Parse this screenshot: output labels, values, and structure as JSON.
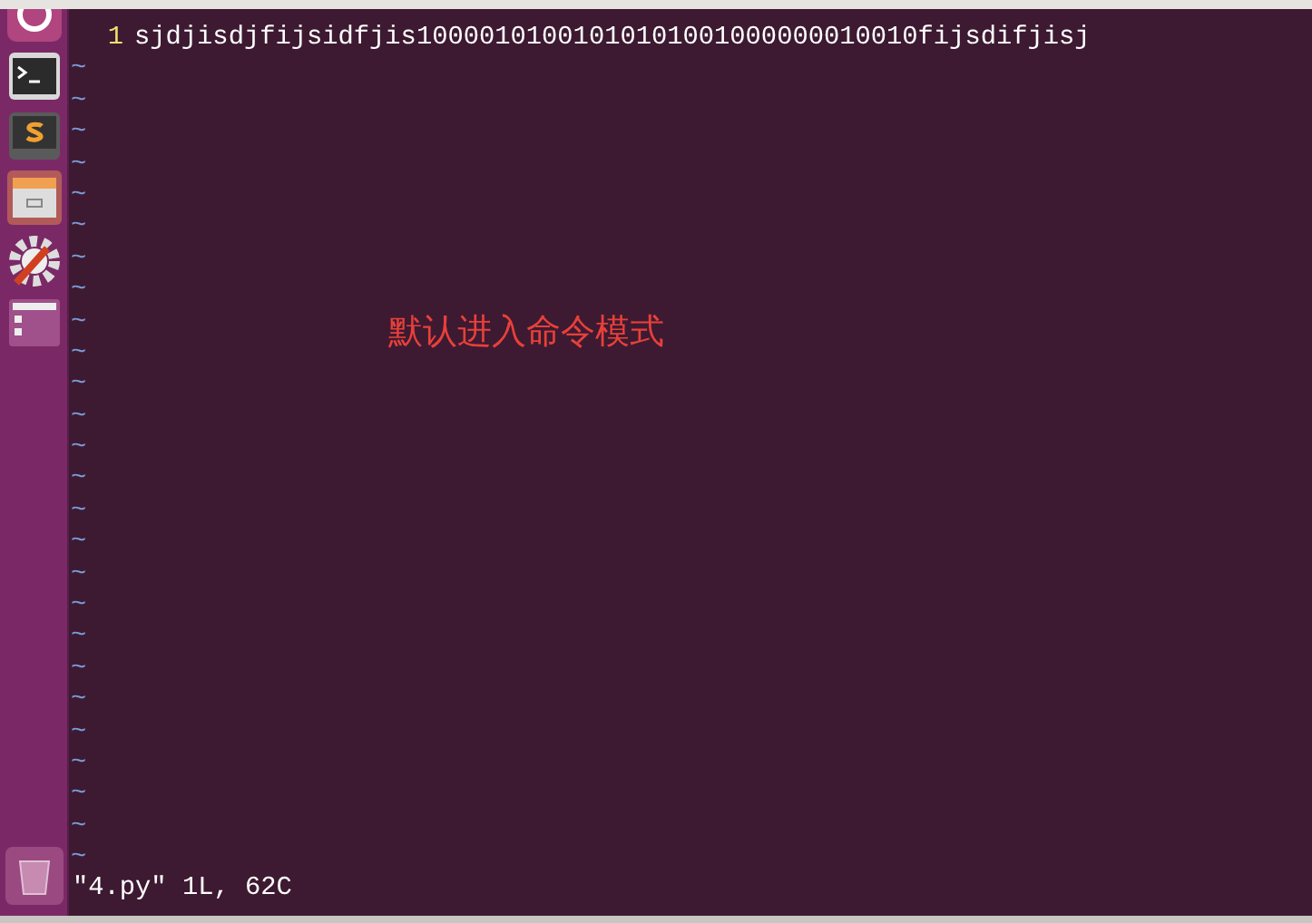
{
  "editor": {
    "lines": [
      {
        "number": "1",
        "text": "sjdjisdjfijsidfjis10000101001010101001000000010010fijsdifjisj"
      }
    ],
    "empty_markers": [
      "~",
      "~",
      "~",
      "~",
      "~",
      "~",
      "~",
      "~",
      "~",
      "~",
      "~",
      "~",
      "~",
      "~",
      "~",
      "~",
      "~",
      "~",
      "~",
      "~",
      "~",
      "~",
      "~",
      "~",
      "~",
      "~"
    ],
    "status_line": "\"4.py\" 1L, 62C"
  },
  "annotation": "默认进入命令模式"
}
